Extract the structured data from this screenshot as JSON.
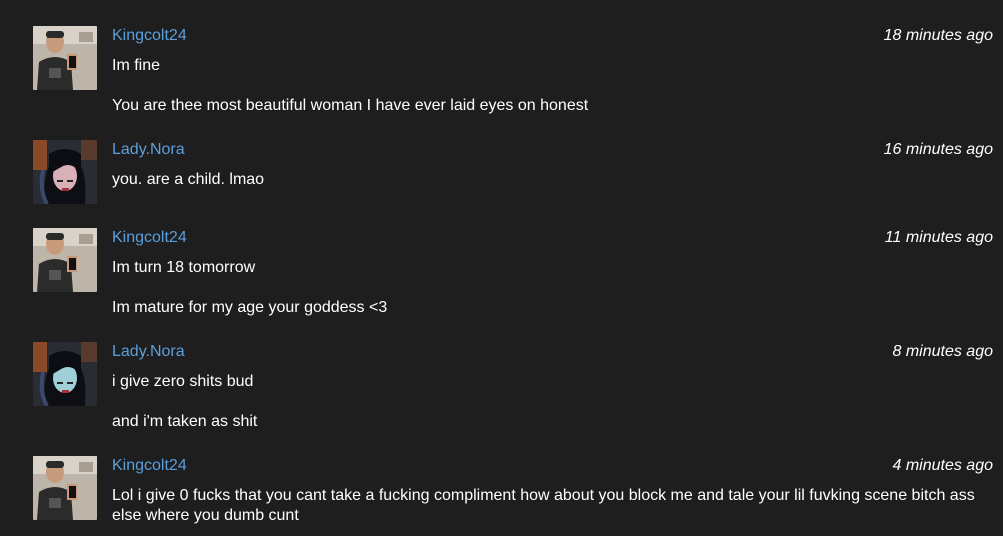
{
  "messages": [
    {
      "user": "Kingcolt24",
      "time": "18 minutes ago",
      "lines": [
        "Im fine",
        "You are thee most beautiful woman I have ever laid eyes on honest"
      ]
    },
    {
      "user": "Lady.Nora",
      "time": "16 minutes ago",
      "lines": [
        "you. are a child. lmao"
      ]
    },
    {
      "user": "Kingcolt24",
      "time": "11 minutes ago",
      "lines": [
        "Im turn 18 tomorrow",
        "Im mature for my age your goddess <3"
      ]
    },
    {
      "user": "Lady.Nora",
      "time": "8 minutes ago",
      "lines": [
        "i give zero shits bud",
        "and i'm taken as shit"
      ]
    },
    {
      "user": "Kingcolt24",
      "time": "4 minutes ago",
      "lines": [
        "Lol i give 0 fucks that you cant take a fucking compliment how about you block me and tale your lil fuvking scene bitch ass else where you dumb cunt"
      ]
    }
  ],
  "colors": {
    "background": "#1e1e1f",
    "username": "#5c9fdc",
    "text": "#ffffff"
  }
}
